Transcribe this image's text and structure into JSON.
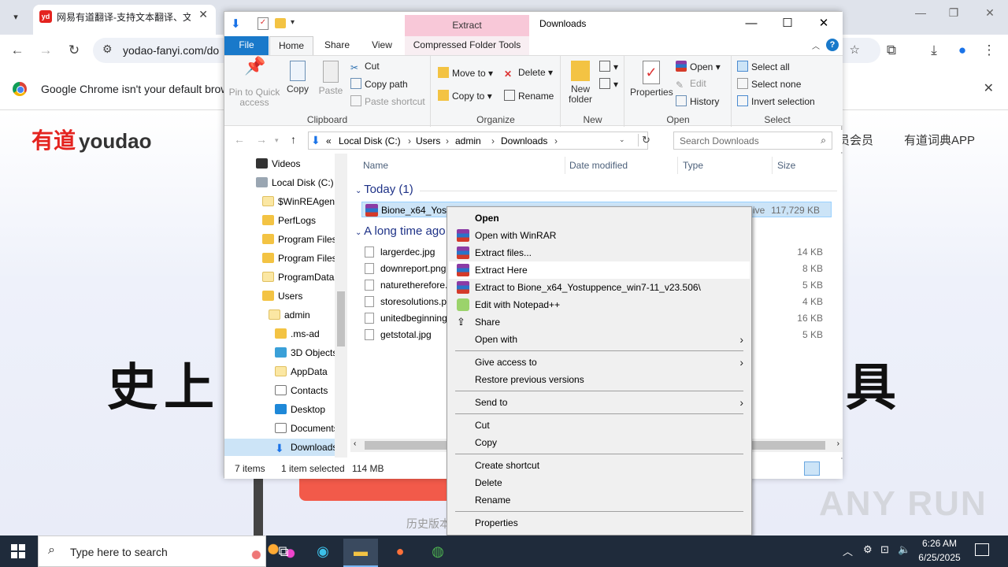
{
  "chrome": {
    "tab_title": "网易有道翻译-支持文本翻译、文",
    "favicon_text": "yd",
    "url": "yodao-fanyi.com/do",
    "infobar_text": "Google Chrome isn't your default browser"
  },
  "page": {
    "logo_cn": "有道",
    "logo_en": "youdao",
    "nav_vip": "员会员",
    "nav_app": "有道词典APP",
    "headline_left": "史上",
    "headline_right": "具",
    "history_link": "历史版本",
    "watermark": "ANY RUN"
  },
  "explorer": {
    "title": "Downloads",
    "extract_tab": "Extract",
    "tabs": {
      "file": "File",
      "home": "Home",
      "share": "Share",
      "view": "View",
      "compressed": "Compressed Folder Tools"
    },
    "ribbon": {
      "clipboard": {
        "label": "Clipboard",
        "pin": "Pin to Quick access",
        "copy": "Copy",
        "paste": "Paste",
        "cut": "Cut",
        "copy_path": "Copy path",
        "paste_shortcut": "Paste shortcut"
      },
      "organize": {
        "label": "Organize",
        "move_to": "Move to",
        "copy_to": "Copy to",
        "delete": "Delete",
        "rename": "Rename"
      },
      "new": {
        "label": "New",
        "new_folder": "New folder"
      },
      "open": {
        "label": "Open",
        "properties": "Properties",
        "open": "Open",
        "edit": "Edit",
        "history": "History"
      },
      "select": {
        "label": "Select",
        "select_all": "Select all",
        "select_none": "Select none",
        "invert": "Invert selection"
      }
    },
    "breadcrumb": [
      "«",
      "Local Disk (C:)",
      "Users",
      "admin",
      "Downloads"
    ],
    "search_placeholder": "Search Downloads",
    "nav_items": [
      "Videos",
      "Local Disk (C:)",
      "$WinREAgent",
      "PerfLogs",
      "Program Files",
      "Program Files",
      "ProgramData",
      "Users",
      "admin",
      ".ms-ad",
      "3D Objects",
      "AppData",
      "Contacts",
      "Desktop",
      "Documents",
      "Downloads"
    ],
    "columns": {
      "name": "Name",
      "date": "Date modified",
      "type": "Type",
      "size": "Size"
    },
    "group_today": "Today (1)",
    "group_old": "A long time ago",
    "selected_file": {
      "name": "Bione_x64_Yostuppence_win7-11_v23.506",
      "type": "ive",
      "size": "117,729 KB"
    },
    "files": [
      {
        "name": "largerdec.jpg",
        "size": "14 KB"
      },
      {
        "name": "downreport.png",
        "size": "8 KB"
      },
      {
        "name": "naturetherefore.",
        "size": "5 KB"
      },
      {
        "name": "storesolutions.p",
        "size": "4 KB"
      },
      {
        "name": "unitedbeginning",
        "size": "16 KB"
      },
      {
        "name": "getstotal.jpg",
        "size": "5 KB"
      }
    ],
    "status": {
      "items": "7 items",
      "selected": "1 item selected",
      "size": "114 MB"
    }
  },
  "context_menu": {
    "open": "Open",
    "open_winrar": "Open with WinRAR",
    "extract_files": "Extract files...",
    "extract_here": "Extract Here",
    "extract_to": "Extract to Bione_x64_Yostuppence_win7-11_v23.506\\",
    "edit_npp": "Edit with Notepad++",
    "share": "Share",
    "open_with": "Open with",
    "give_access": "Give access to",
    "restore": "Restore previous versions",
    "send_to": "Send to",
    "cut": "Cut",
    "copy": "Copy",
    "create_shortcut": "Create shortcut",
    "delete": "Delete",
    "rename": "Rename",
    "properties": "Properties"
  },
  "taskbar": {
    "search_placeholder": "Type here to search",
    "time": "6:26 AM",
    "date": "6/25/2025"
  }
}
